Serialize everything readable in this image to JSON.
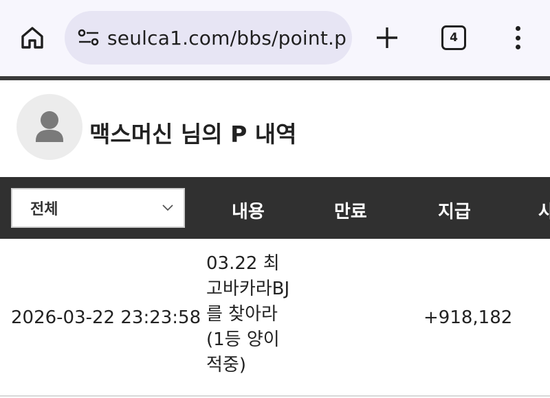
{
  "browser": {
    "url": "seulca1.com/bbs/point.p",
    "tab_count": "4"
  },
  "profile": {
    "title": "맥스머신 님의 P 내역"
  },
  "table": {
    "filter": {
      "selected": "전체"
    },
    "headers": [
      "내용",
      "만료",
      "지급",
      "사"
    ],
    "rows": [
      {
        "date": "2026-03-22 23:23:58",
        "content": "03.22 최고바카라BJ를 찾아라 (1등 양이 적중)",
        "expire": "",
        "pay": "+918,182"
      }
    ]
  },
  "colors": {
    "browser_bg": "#f7f6fd",
    "url_pill": "#e7e5f4",
    "header_bg": "#303030",
    "avatar_bg": "#ececec"
  },
  "icons": [
    "home-icon",
    "site-settings-icon",
    "plus-icon",
    "tab-switcher-icon",
    "more-vert-icon",
    "user-avatar-icon",
    "chevron-down-icon"
  ]
}
